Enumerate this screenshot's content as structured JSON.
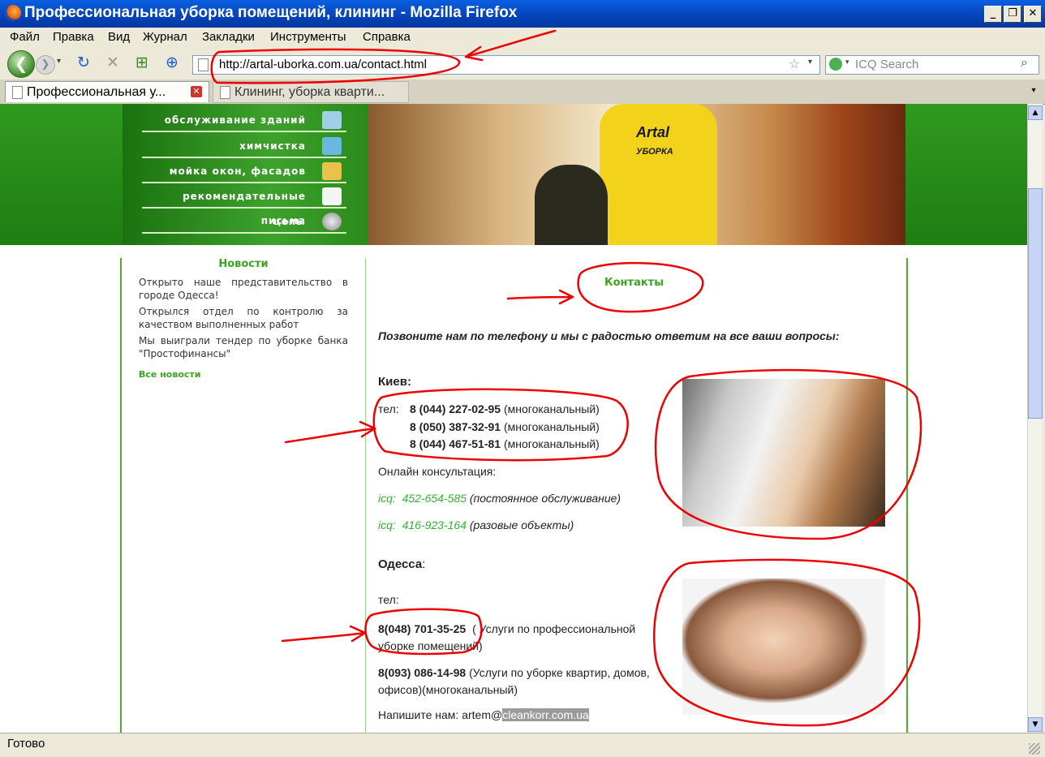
{
  "window": {
    "title": "Профессиональная уборка помещений, клининг - Mozilla Firefox"
  },
  "menu": [
    "Файл",
    "Правка",
    "Вид",
    "Журнал",
    "Закладки",
    "Инструменты",
    "Справка"
  ],
  "url": "http://artal-uborka.com.ua/contact.html",
  "search_placeholder": "ICQ Search",
  "tabs": [
    {
      "label": "Профессиональная у..."
    },
    {
      "label": "Клининг, уборка кварти..."
    }
  ],
  "site_nav": [
    "обслуживание зданий",
    "химчистка",
    "мойка окон, фасадов",
    "рекомендательные письма",
    "цены"
  ],
  "header_photo_text": {
    "brand": "Artal",
    "sub": "УБОРКА"
  },
  "news": {
    "title": "Новости",
    "items": [
      "Открыто наше представительство в городе Одесса!",
      "Открылся отдел по контролю за качеством выполненных работ",
      "Мы выиграли тендер по уборке банка \"Простофинансы\""
    ],
    "all_link": "Все новости"
  },
  "contacts": {
    "title": "Контакты",
    "intro": "Позвоните нам по телефону и мы с радостью ответим на все ваши вопросы:",
    "kiev": {
      "city": "Киев:",
      "tel_label": "тел:",
      "phones": [
        {
          "number": "8 (044) 227-02-95",
          "note": "(многоканальный)"
        },
        {
          "number": "8 (050) 387-32-91",
          "note": "(многоканальный)"
        },
        {
          "number": "8 (044) 467-51-81",
          "note": "(многоканальный)"
        }
      ],
      "online_label": "Онлайн консультация:",
      "icq": [
        {
          "label": "icq:",
          "number": "452-654-585",
          "note": "(постоянное обслуживание)"
        },
        {
          "label": "icq:",
          "number": "416-923-164",
          "note": "(разовые объекты)"
        }
      ]
    },
    "odessa": {
      "city": "Одесса",
      "tel_label": "тел:",
      "phone1": {
        "number": "8(048)  701-35-25",
        "note_line1": "( Услуги по профессиональной",
        "note_line2": "уборке помещений)"
      },
      "phone2": {
        "number": "8(093)  086-14-98",
        "note_line1": "(Услуги по уборке квартир, домов,",
        "note_line2": "офисов)(многоканальный)"
      },
      "write_label": "Напишите нам: artem@",
      "email_domain": "cleankorr.com.ua"
    }
  },
  "status": "Готово"
}
